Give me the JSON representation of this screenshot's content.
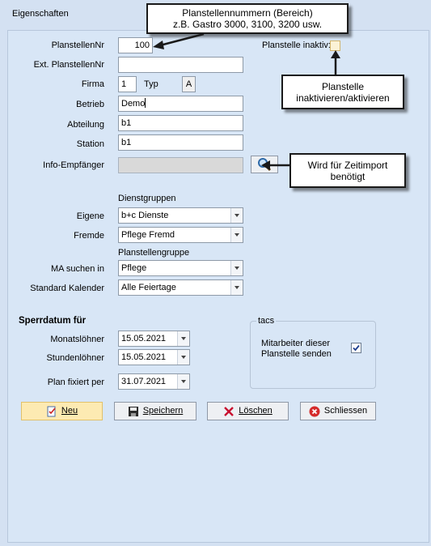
{
  "window": {
    "title": "Eigenschaften"
  },
  "callouts": {
    "range": {
      "line1": "Planstellennummern (Bereich)",
      "line2": "z.B. Gastro 3000, 3100, 3200 usw."
    },
    "inactive": {
      "line1": "Planstelle",
      "line2": "inaktivieren/aktivieren"
    },
    "import": {
      "line1": "Wird für Zeitimport",
      "line2": "benötigt"
    }
  },
  "form": {
    "planstellennr": {
      "label": "PlanstellenNr",
      "value": "100"
    },
    "inactive": {
      "label": "Planstelle inaktiv:",
      "checked": false
    },
    "ext_planstellennr": {
      "label": "Ext. PlanstellenNr",
      "value": ""
    },
    "firma": {
      "label": "Firma",
      "value": "1"
    },
    "typ": {
      "label": "Typ",
      "value": "A"
    },
    "betrieb": {
      "label": "Betrieb",
      "value": "Demo"
    },
    "abteilung": {
      "label": "Abteilung",
      "value": "b1"
    },
    "station": {
      "label": "Station",
      "value": "b1"
    },
    "info_empfaenger": {
      "label": "Info-Empfänger",
      "value": ""
    },
    "dienstgruppen_heading": "Dienstgruppen",
    "eigene": {
      "label": "Eigene",
      "value": "b+c Dienste"
    },
    "fremde": {
      "label": "Fremde",
      "value": "Pflege Fremd"
    },
    "planstellengruppe_heading": "Planstellengruppe",
    "ma_suchen_in": {
      "label": "MA suchen in",
      "value": "Pflege"
    },
    "standard_kalender": {
      "label": "Standard Kalender",
      "value": "Alle Feiertage"
    }
  },
  "sperrdatum": {
    "heading": "Sperrdatum für",
    "monatsloehner": {
      "label": "Monatslöhner",
      "value": "15.05.2021"
    },
    "stundenloehner": {
      "label": "Stundenlöhner",
      "value": "15.05.2021"
    },
    "plan_fixiert": {
      "label": "Plan fixiert per",
      "value": "31.07.2021"
    }
  },
  "tacs": {
    "title": "tacs",
    "send_label_line1": "Mitarbeiter dieser",
    "send_label_line2": "Planstelle senden",
    "checked": true
  },
  "buttons": {
    "neu": "Neu",
    "speichern": "Speichern",
    "loeschen": "Löschen",
    "schliessen": "Schliessen"
  },
  "icons": {
    "new": "new-document-icon",
    "save": "floppy-disk-icon",
    "delete": "red-x-icon",
    "close": "close-circle-icon",
    "search": "magnifier-icon"
  },
  "colors": {
    "accent_button": "#fdeab2",
    "panel": "#d8e6f6",
    "close_red": "#d52b2b"
  }
}
